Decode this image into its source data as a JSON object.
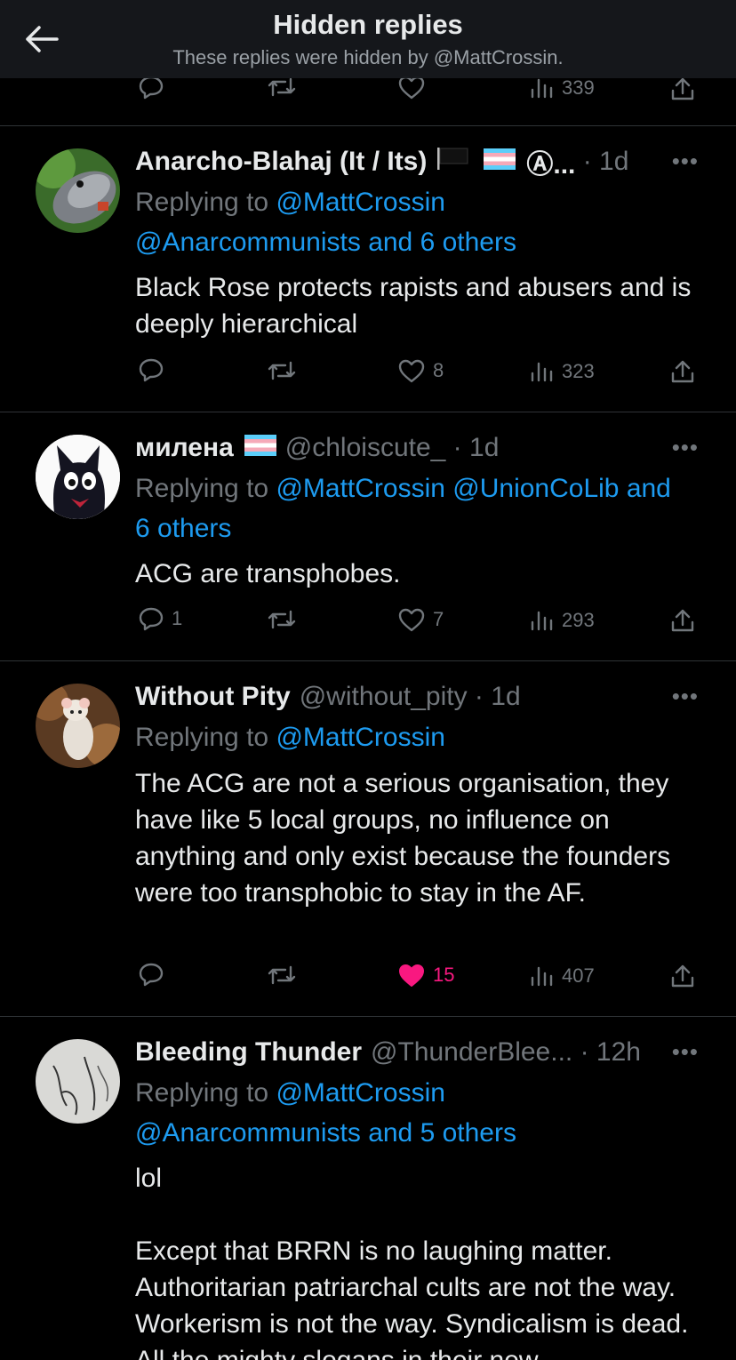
{
  "header": {
    "title": "Hidden replies",
    "subtitle": "These replies were hidden by @MattCrossin."
  },
  "prev_actions": {
    "views": "339"
  },
  "tweets": [
    {
      "name": "Anarcho-Blahaj (It / Its)",
      "name_suffix": "Ⓐ...",
      "handle": "",
      "time": "1d",
      "replying_prefix": "Replying to ",
      "replying_line1": "@MattCrossin",
      "replying_line2": "@Anarcommunists and 6 others",
      "text": "Black Rose protects rapists and abusers and is deeply hierarchical",
      "replies": "",
      "likes": "8",
      "views": "323"
    },
    {
      "name": "милена",
      "name_suffix": "",
      "handle": "@chloiscute_",
      "time": "1d",
      "replying_prefix": "Replying to ",
      "replying_line1": "@MattCrossin @UnionCoLib and",
      "replying_line2": "6 others",
      "text": "ACG are transphobes.",
      "replies": "1",
      "likes": "7",
      "views": "293"
    },
    {
      "name": "Without Pity",
      "name_suffix": "",
      "handle": "@without_pity",
      "time": "1d",
      "replying_prefix": "Replying to ",
      "replying_line1": "@MattCrossin",
      "replying_line2": "",
      "text": "The ACG are not a serious organisation, they have like 5 local groups, no influence on anything and only exist because the founders were too transphobic to stay in the AF.",
      "replies": "",
      "likes": "15",
      "views": "407"
    },
    {
      "name": "Bleeding Thunder",
      "name_suffix": "",
      "handle": "@ThunderBlee...",
      "time": "12h",
      "replying_prefix": "Replying to ",
      "replying_line1": "@MattCrossin",
      "replying_line2": "@Anarcommunists and 5 others",
      "text": "lol\n\nExcept that BRRN is no laughing matter. Authoritarian patriarchal cults are not the way. Workerism is not the way. Syndicalism is dead. All the mighty slogans in their new",
      "replies": "",
      "likes": "",
      "views": ""
    }
  ],
  "colors": {
    "background": "#000000",
    "link": "#1d9bf0",
    "muted": "#71767b",
    "like": "#f91880"
  }
}
